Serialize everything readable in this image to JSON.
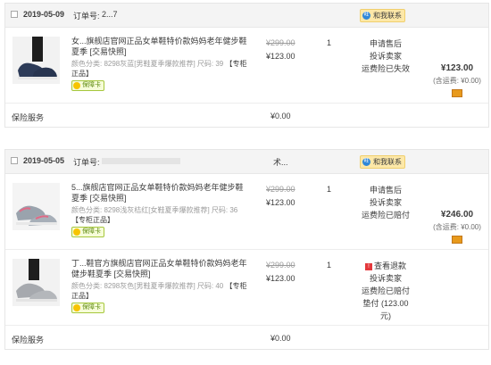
{
  "orders": [
    {
      "date": "2019-05-09",
      "order_label": "订单号:",
      "order_number": "2...7",
      "seller": "",
      "contact": "和我联系",
      "total": "¥123.00",
      "shipping": "(含运费: ¥0.00)",
      "items": [
        {
          "title": "女...旗舰店官网正品女单鞋特价款妈妈老年健步鞋夏季 [交易快照]",
          "sku": "颜色分类: 8298灰蓝[男鞋夏季爆款推荐] 尺码: 39",
          "sku_tag": "【专柜正品】",
          "insurance": "保障卡",
          "orig_price": "¥299.00",
          "price": "¥123.00",
          "qty": "1",
          "actions": [
            "申请售后",
            "投诉卖家",
            "运费险已失效"
          ],
          "colors": [
            "#2d3b58",
            "#e8e8e8"
          ]
        }
      ],
      "service": {
        "label": "保险服务",
        "price": "¥0.00"
      }
    },
    {
      "date": "2019-05-05",
      "order_label": "订单号:",
      "order_number": "",
      "seller": "术...",
      "contact": "和我联系",
      "total": "¥246.00",
      "shipping": "(含运费: ¥0.00)",
      "items": [
        {
          "title": "5...旗舰店官网正品女单鞋特价款妈妈老年健步鞋夏季 [交易快照]",
          "sku": "颜色分类: 8298浅灰桔红[女鞋夏季爆款推荐] 尺码: 36",
          "sku_tag": "【专柜正品】",
          "insurance": "保障卡",
          "orig_price": "¥299.00",
          "price": "¥123.00",
          "qty": "1",
          "actions": [
            "申请售后",
            "投诉卖家",
            "运费险已赔付"
          ],
          "colors": [
            "#9aa3ad",
            "#e06a86"
          ]
        },
        {
          "title": "丁...鞋官方旗舰店官网正品女单鞋特价款妈妈老年健步鞋夏季 [交易快照]",
          "sku": "颜色分类: 8298灰色[男鞋夏季爆款推荐] 尺码: 40",
          "sku_tag": "【专柜正品】",
          "insurance": "保障卡",
          "orig_price": "¥299.00",
          "price": "¥123.00",
          "qty": "1",
          "actions": [
            "查看退款",
            "投诉卖家",
            "运费险已赔付",
            "垫付 (123.00元)"
          ],
          "colors": [
            "#a6a9ae",
            "#cfd2d6"
          ]
        }
      ],
      "service": {
        "label": "保险服务",
        "price": "¥0.00"
      }
    }
  ]
}
